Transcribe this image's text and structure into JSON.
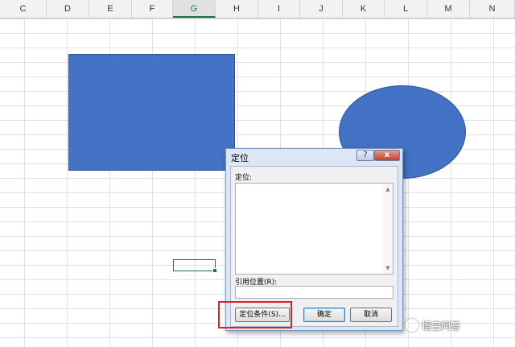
{
  "spreadsheet": {
    "columns": [
      "C",
      "D",
      "E",
      "F",
      "G",
      "H",
      "I",
      "J",
      "K",
      "L",
      "M",
      "N"
    ],
    "active_column": "G"
  },
  "dialog": {
    "title": "定位",
    "help_button": "?",
    "close_button": "x",
    "goto_label": "定位:",
    "reference_label": "引用位置(R):",
    "reference_value": "",
    "special_button": "定位条件(S)...",
    "ok_button": "确定",
    "cancel_button": "取消"
  },
  "colors": {
    "shape_fill": "#4472c4",
    "highlight": "#e02020",
    "active_cell": "#217346"
  },
  "watermark": {
    "text": "悟空问答"
  }
}
